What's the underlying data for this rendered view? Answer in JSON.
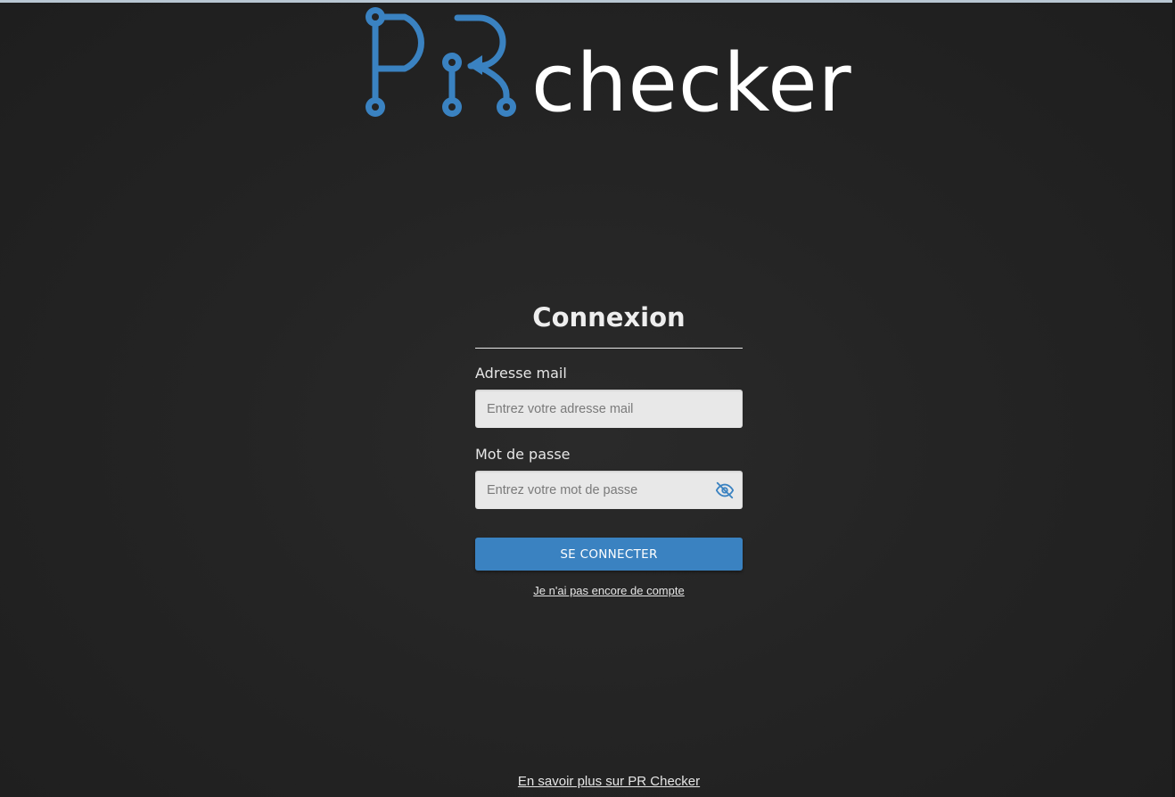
{
  "brand": {
    "logo_letters": "PR",
    "logo_word": "checker",
    "accent_color": "#3a82c1",
    "icon_name": "circuit-pr-logo-icon"
  },
  "login": {
    "title": "Connexion",
    "email": {
      "label": "Adresse mail",
      "placeholder": "Entrez votre adresse mail",
      "value": ""
    },
    "password": {
      "label": "Mot de passe",
      "placeholder": "Entrez votre mot de passe",
      "value": "",
      "toggle_icon": "eye-slash-icon"
    },
    "submit_label": "SE CONNECTER",
    "signup_link": "Je n'ai pas encore de compte"
  },
  "footer": {
    "learn_more_link": "En savoir plus sur PR Checker"
  }
}
